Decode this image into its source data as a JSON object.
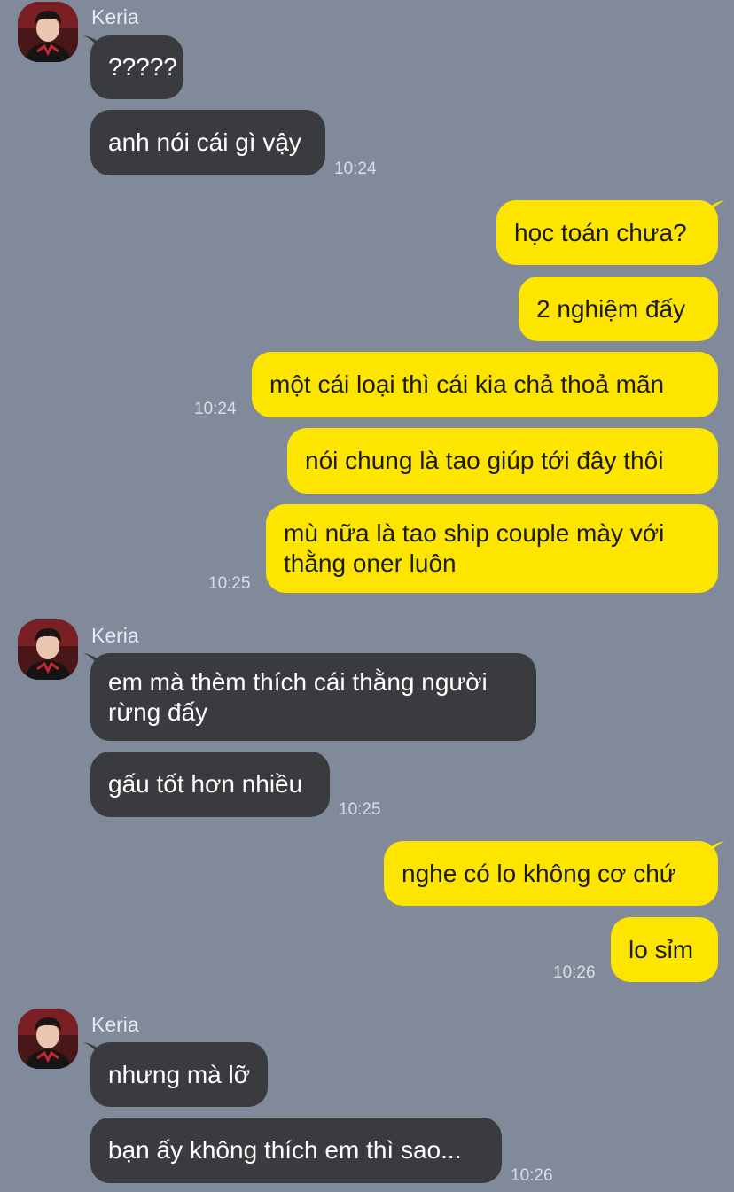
{
  "colors": {
    "background": "#808a9a",
    "incoming_bubble": "#3a3b3e",
    "outgoing_bubble": "#fee500"
  },
  "contact": {
    "name": "Keria",
    "avatar_icon": "profile-photo-icon"
  },
  "groups": [
    {
      "direction": "in",
      "sender": "Keria",
      "messages": [
        "?????",
        "anh nói cái gì vậy"
      ],
      "time": "10:24"
    },
    {
      "direction": "out",
      "messages": [
        "học toán chưa?",
        "2 nghiệm đấy",
        "một cái loại thì cái kia chả thoả mãn"
      ],
      "time": "10:24"
    },
    {
      "direction": "out",
      "messages": [
        "nói chung là tao giúp tới đây thôi",
        "mù nữa là tao ship couple mày với thằng oner luôn"
      ],
      "time": "10:25"
    },
    {
      "direction": "in",
      "sender": "Keria",
      "messages": [
        "em mà thèm thích cái thằng người rừng đấy",
        "gấu tốt hơn nhiều"
      ],
      "time": "10:25"
    },
    {
      "direction": "out",
      "messages": [
        "nghe có lo không cơ chứ",
        "lo sỉm"
      ],
      "time": "10:26"
    },
    {
      "direction": "in",
      "sender": "Keria",
      "messages": [
        "nhưng mà lỡ",
        "bạn ấy không thích em thì sao..."
      ],
      "time": "10:26"
    }
  ]
}
